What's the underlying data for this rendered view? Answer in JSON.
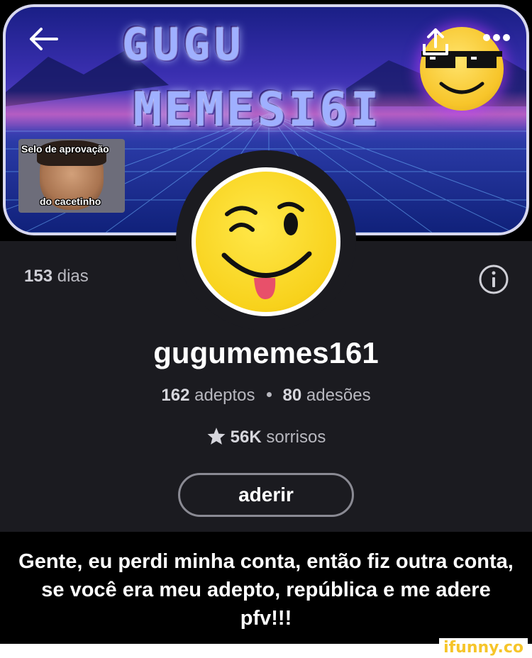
{
  "banner": {
    "title_line1": "GUGU",
    "title_line2": "MEMESI6I",
    "badge_top": "Selo de aprovação",
    "badge_bottom": "do cacetinho"
  },
  "toolbar": {
    "back_icon": "arrow-left-icon",
    "share_icon": "share-icon",
    "more_icon": "more-dots-icon"
  },
  "profile": {
    "days_value": "153",
    "days_label": "dias",
    "username": "gugumemes161",
    "followers_value": "162",
    "followers_label": "adeptos",
    "subscriptions_value": "80",
    "subscriptions_label": "adesões",
    "smiles_value": "56K",
    "smiles_label": "sorrisos",
    "join_label": "aderir"
  },
  "caption": {
    "text": "Gente, eu perdi minha conta, então fiz outra conta, se você era meu adepto, república e me adere pfv!!!"
  },
  "watermark": "ifunny.co",
  "colors": {
    "background": "#1b1b20",
    "accent_yellow": "#f8d21c",
    "muted_text": "#b8b8bf"
  }
}
